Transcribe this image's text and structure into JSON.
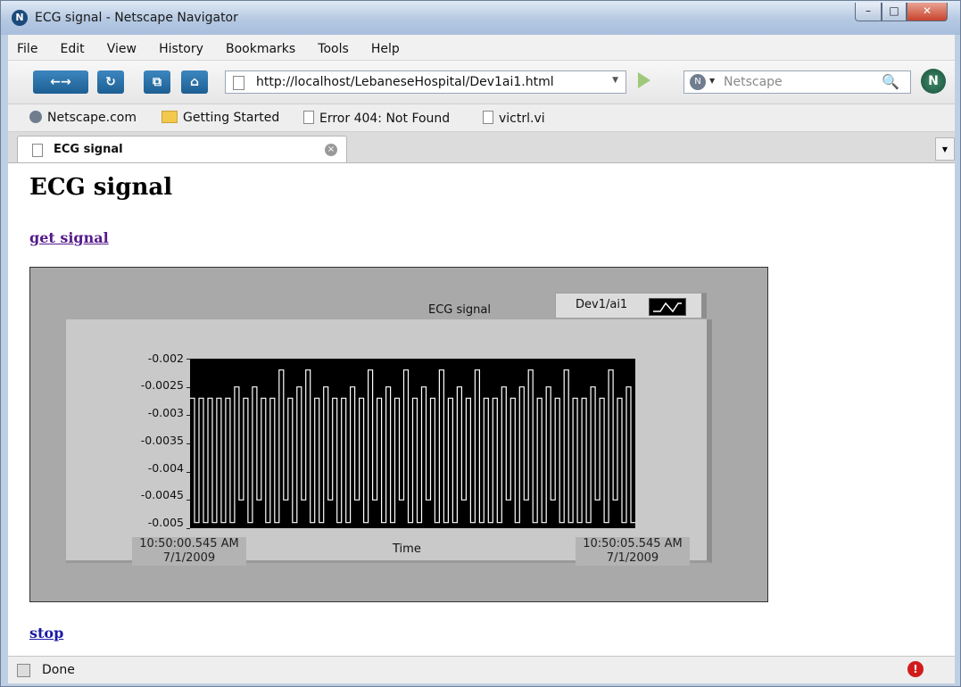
{
  "window": {
    "title": "ECG signal - Netscape Navigator",
    "min": "–",
    "max": "□",
    "close": "✕"
  },
  "menu": [
    "File",
    "Edit",
    "View",
    "History",
    "Bookmarks",
    "Tools",
    "Help"
  ],
  "nav": {
    "url": "http://localhost/LebaneseHospital/Dev1ai1.html",
    "search_placeholder": "Netscape",
    "back_glyph": "←→",
    "reload_glyph": "↻",
    "tabs_glyph": "⧉",
    "home_glyph": "⌂",
    "search_glyph": "🔍",
    "logo_letter": "N"
  },
  "bookmarks": [
    "Netscape.com",
    "Getting Started",
    "Error 404: Not Found",
    "victrl.vi"
  ],
  "tab": {
    "label": "ECG signal",
    "close_glyph": "×",
    "list_glyph": "▼"
  },
  "page": {
    "heading": "ECG signal",
    "get_link": "get signal",
    "stop_link": "stop"
  },
  "graph": {
    "title": "ECG signal",
    "legend_name": "Dev1/ai1",
    "xlabel": "Time",
    "x_start_time": "10:50:00.545 AM",
    "x_start_date": "7/1/2009",
    "x_end_time": "10:50:05.545 AM",
    "x_end_date": "7/1/2009",
    "y_ticks": [
      "-0.002",
      "-0.0025",
      "-0.003",
      "-0.0035",
      "-0.004",
      "-0.0045",
      "-0.005"
    ]
  },
  "status": {
    "text": "Done",
    "warn_glyph": "!"
  },
  "chart_data": {
    "type": "line",
    "title": "ECG signal",
    "xlabel": "Time",
    "ylabel": "",
    "ylim": [
      -0.005,
      -0.002
    ],
    "xlim": [
      "7/1/2009 10:50:00.545 AM",
      "7/1/2009 10:50:05.545 AM"
    ],
    "series": [
      {
        "name": "Dev1/ai1",
        "color": "#ffffff",
        "levels": [
          -0.0027,
          -0.0049,
          -0.0027,
          -0.0049,
          -0.0027,
          -0.0049,
          -0.0027,
          -0.0049,
          -0.0027,
          -0.0049,
          -0.0025,
          -0.0045,
          -0.0027,
          -0.0049,
          -0.0025,
          -0.0045,
          -0.0027,
          -0.0049,
          -0.0027,
          -0.0049,
          -0.0022,
          -0.0045,
          -0.0027,
          -0.0049,
          -0.0025,
          -0.0045,
          -0.0022,
          -0.0049,
          -0.0027,
          -0.0049,
          -0.0025,
          -0.0045,
          -0.0027,
          -0.0049,
          -0.0027,
          -0.0049,
          -0.0025,
          -0.0045,
          -0.0027,
          -0.0049,
          -0.0022,
          -0.0045,
          -0.0027,
          -0.0049,
          -0.0025,
          -0.0049,
          -0.0027,
          -0.0045,
          -0.0022,
          -0.0049,
          -0.0027,
          -0.0049,
          -0.0025,
          -0.0045,
          -0.0027,
          -0.0049,
          -0.0022,
          -0.0049,
          -0.0027,
          -0.0049,
          -0.0025,
          -0.0045,
          -0.0027,
          -0.0049,
          -0.0022,
          -0.0049,
          -0.0027,
          -0.0049,
          -0.0027,
          -0.0049,
          -0.0025,
          -0.0045,
          -0.0027,
          -0.0049,
          -0.0025,
          -0.0045,
          -0.0022,
          -0.0049,
          -0.0027,
          -0.0049,
          -0.0025,
          -0.0045,
          -0.0027,
          -0.0049,
          -0.0022,
          -0.0049,
          -0.0027,
          -0.0049,
          -0.0027,
          -0.0049,
          -0.0025,
          -0.0045,
          -0.0027,
          -0.0049,
          -0.0022,
          -0.0045,
          -0.0027,
          -0.0049,
          -0.0025,
          -0.0049
        ]
      }
    ],
    "grid": false,
    "legend": "top-right"
  }
}
